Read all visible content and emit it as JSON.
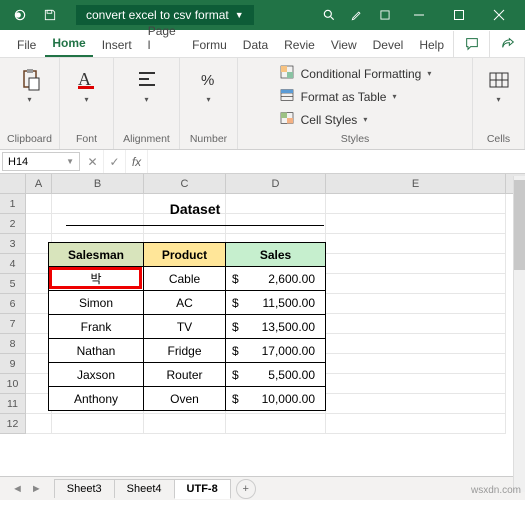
{
  "titlebar": {
    "doc_name": "convert excel to csv format"
  },
  "menus": {
    "file": "File",
    "home": "Home",
    "insert": "Insert",
    "page": "Page l",
    "formulas": "Formu",
    "data": "Data",
    "review": "Revie",
    "view": "View",
    "developer": "Devel",
    "help": "Help"
  },
  "ribbon_groups": {
    "clipboard": "Clipboard",
    "font": "Font",
    "alignment": "Alignment",
    "number": "Number",
    "styles": "Styles",
    "cells": "Cells"
  },
  "style_items": {
    "cond_format": "Conditional Formatting",
    "format_table": "Format as Table",
    "cell_styles": "Cell Styles"
  },
  "namebox": "H14",
  "dataset_title": "Dataset",
  "headers": {
    "a": "Salesman",
    "b": "Product",
    "c": "Sales"
  },
  "rows": [
    {
      "salesman": "박",
      "product": "Cable",
      "sales_sym": "$",
      "sales_val": "2,600.00"
    },
    {
      "salesman": "Simon",
      "product": "AC",
      "sales_sym": "$",
      "sales_val": "11,500.00"
    },
    {
      "salesman": "Frank",
      "product": "TV",
      "sales_sym": "$",
      "sales_val": "13,500.00"
    },
    {
      "salesman": "Nathan",
      "product": "Fridge",
      "sales_sym": "$",
      "sales_val": "17,000.00"
    },
    {
      "salesman": "Jaxson",
      "product": "Router",
      "sales_sym": "$",
      "sales_val": "5,500.00"
    },
    {
      "salesman": "Anthony",
      "product": "Oven",
      "sales_sym": "$",
      "sales_val": "10,000.00"
    }
  ],
  "columns": [
    "A",
    "B",
    "C",
    "D",
    "E"
  ],
  "row_nums": [
    "1",
    "2",
    "3",
    "4",
    "5",
    "6",
    "7",
    "8",
    "9",
    "10",
    "11",
    "12"
  ],
  "sheets": {
    "s3": "Sheet3",
    "s4": "Sheet4",
    "utf": "UTF-8"
  },
  "watermark": "wsxdn.com"
}
